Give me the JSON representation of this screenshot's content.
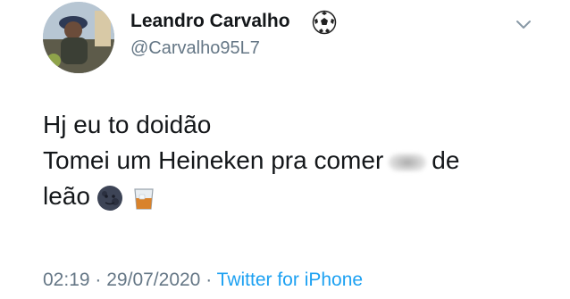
{
  "user": {
    "display_name": "Leandro Carvalho",
    "handle": "@Carvalho95L7",
    "name_emoji": "soccer-ball-icon"
  },
  "tweet": {
    "line1": "Hj eu to doidão",
    "line2_before": "Tomei um Heineken pra comer",
    "censored_word": "cu",
    "line2_after": "de",
    "line3": "leão",
    "emojis": [
      "new-moon-face-icon",
      "tumbler-glass-icon"
    ]
  },
  "meta": {
    "time": "02:19",
    "separator": "·",
    "date": "29/07/2020",
    "source": "Twitter for iPhone"
  },
  "colors": {
    "text": "#14171a",
    "secondary": "#657786",
    "link": "#1da1f2"
  }
}
